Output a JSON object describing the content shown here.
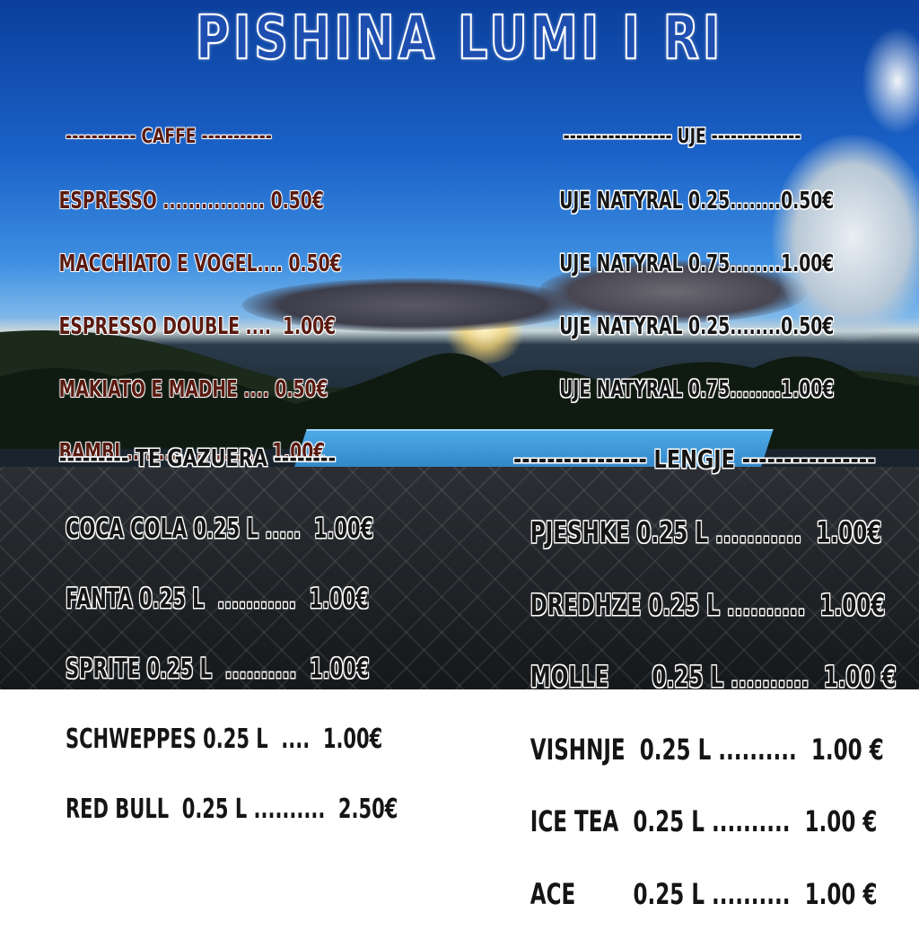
{
  "title": "PISHINA LUMI I RI",
  "menus": {
    "caffe": {
      "heading": "----------- CAFFE -----------",
      "items": [
        "ESPRESSO ................ 0.50€",
        "MACCHIATO E VOGEL.... 0.50€",
        "ESPRESSO DOUBLE ....  1.00€",
        "MAKIATO E MADHE .... 0.50€",
        "BAMBI .....................  1.00€"
      ]
    },
    "uje": {
      "heading": "----------------- UJE --------------",
      "items": [
        "UJE NATYRAL 0.25........0.50€",
        "UJE NATYRAL 0.75........1.00€",
        "UJE NATYRAL 0.25........0.50€",
        "UJE NATYRAL 0.75........1.00€"
      ]
    },
    "te_gazuera": {
      "heading": "--------- TE GAZUERA --------",
      "items": [
        "COCA COLA 0.25 L .....  1.00€",
        "FANTA 0.25 L  ...........  1.00€",
        "SPRITE 0.25 L  ..........  1.00€",
        "SCHWEPPES 0.25 L  ....  1.00€",
        "RED BULL  0.25 L ..........  2.50€"
      ]
    },
    "lengje": {
      "heading": "---------------- LENGJE ----------------",
      "items": [
        "PJESHKE 0.25 L ...........  1.00€",
        "DREDHZE 0.25 L ..........  1.00€",
        "MOLLE      0.25 L ..........  1.00 €",
        "VISHNJE  0.25 L ..........  1.00 €",
        "ICE TEA  0.25 L ..........  1.00 €",
        "ACE        0.25 L ..........  1.00 €"
      ]
    }
  }
}
